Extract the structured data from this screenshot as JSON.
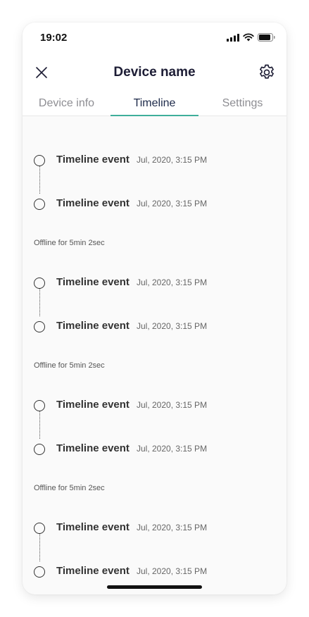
{
  "status_bar": {
    "time": "19:02"
  },
  "header": {
    "title": "Device name",
    "close_icon": "close-icon",
    "settings_icon": "gear-icon"
  },
  "tabs": [
    {
      "label": "Device info",
      "active": false
    },
    {
      "label": "Timeline",
      "active": true
    },
    {
      "label": "Settings",
      "active": false
    }
  ],
  "accent_color": "#3fae9a",
  "timeline": {
    "groups": [
      {
        "events": [
          {
            "title": "Timeline event",
            "time": "Jul, 2020, 3:15 PM"
          },
          {
            "title": "Timeline event",
            "time": "Jul, 2020, 3:15 PM"
          }
        ],
        "gap_text": "Offline for 5min 2sec"
      },
      {
        "events": [
          {
            "title": "Timeline event",
            "time": "Jul, 2020, 3:15 PM"
          },
          {
            "title": "Timeline event",
            "time": "Jul, 2020, 3:15 PM"
          }
        ],
        "gap_text": "Offline for 5min 2sec"
      },
      {
        "events": [
          {
            "title": "Timeline event",
            "time": "Jul, 2020, 3:15 PM"
          },
          {
            "title": "Timeline event",
            "time": "Jul, 2020, 3:15 PM"
          }
        ],
        "gap_text": "Offline for 5min 2sec"
      },
      {
        "events": [
          {
            "title": "Timeline event",
            "time": "Jul, 2020, 3:15 PM"
          },
          {
            "title": "Timeline event",
            "time": "Jul, 2020, 3:15 PM"
          }
        ]
      }
    ]
  }
}
